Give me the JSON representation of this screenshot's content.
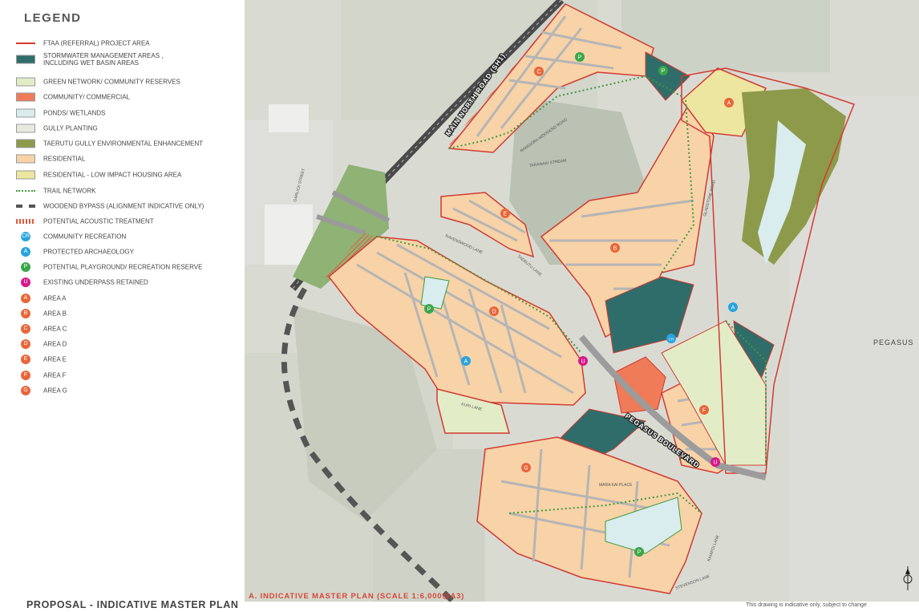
{
  "legend": {
    "title": "LEGEND",
    "items": [
      {
        "label": "FTAA (REFERRAL) PROJECT AREA",
        "symbol": "red-line",
        "color": "#d23a31"
      },
      {
        "label": "STORMWATER MANAGEMENT AREAS ,\nINCLUDING WET BASIN AREAS",
        "symbol": "fill",
        "color": "#2f6d6a"
      },
      {
        "label": "GREEN NETWORK/ COMMUNITY RESERVES",
        "symbol": "fill",
        "color": "#e2edc8"
      },
      {
        "label": "COMMUNITY/ COMMERCIAL",
        "symbol": "fill",
        "color": "#ef7b59"
      },
      {
        "label": "PONDS/ WETLANDS",
        "symbol": "fill",
        "color": "#d9ecee"
      },
      {
        "label": "GULLY PLANTING",
        "symbol": "fill",
        "color": "#e9eadf"
      },
      {
        "label": "TAERUTU GULLY ENVIRONMENTAL ENHANCEMENT",
        "symbol": "fill",
        "color": "#8d9a4a"
      },
      {
        "label": "RESIDENTIAL",
        "symbol": "fill",
        "color": "#f8d3a8"
      },
      {
        "label": "RESIDENTIAL - LOW IMPACT HOUSING AREA",
        "symbol": "fill",
        "color": "#ede6a0"
      },
      {
        "label": "TRAIL NETWORK",
        "symbol": "dots",
        "color": "#3f9a3a"
      },
      {
        "label": "WOODEND BYPASS (ALIGNMENT INDICATIVE ONLY)",
        "symbol": "dash",
        "color": "#555555"
      },
      {
        "label": "POTENTIAL ACOUSTIC TREATMENT",
        "symbol": "hatch",
        "color": "#e25b3c"
      },
      {
        "label": "COMMUNITY RECREATION",
        "symbol": "circle",
        "color": "#29a3dc",
        "letter": "CR"
      },
      {
        "label": "PROTECTED ARCHAEOLOGY",
        "symbol": "circle",
        "color": "#29a3dc",
        "letter": "A"
      },
      {
        "label": "POTENTIAL PLAYGROUND/ RECREATION RESERVE",
        "symbol": "circle",
        "color": "#3aa64a",
        "letter": "P"
      },
      {
        "label": "EXISTING UNDERPASS RETAINED",
        "symbol": "circle",
        "color": "#d6198a",
        "letter": "U"
      },
      {
        "label": "AREA A",
        "symbol": "circle",
        "color": "#e8663a",
        "letter": "A"
      },
      {
        "label": "AREA B",
        "symbol": "circle",
        "color": "#e8663a",
        "letter": "B"
      },
      {
        "label": "AREA C",
        "symbol": "circle",
        "color": "#e8663a",
        "letter": "C"
      },
      {
        "label": "AREA D",
        "symbol": "circle",
        "color": "#e8663a",
        "letter": "D"
      },
      {
        "label": "AREA E",
        "symbol": "circle",
        "color": "#e8663a",
        "letter": "E"
      },
      {
        "label": "AREA F",
        "symbol": "circle",
        "color": "#e8663a",
        "letter": "F"
      },
      {
        "label": "AREA G",
        "symbol": "circle",
        "color": "#e8663a",
        "letter": "G"
      }
    ]
  },
  "map": {
    "labels": {
      "main_north_road": "MAIN NORTH ROAD (SH1)",
      "pegasus_boulevard": "PEGASUS BOULEVARD",
      "pegasus": "PEGASUS",
      "garlick_street": "GARLICK STREET",
      "taranaki_stream": "TARANAKI STREAM",
      "rangiora_woodend_road": "RANGIORA WOODEND ROAD",
      "gladstone_road": "GLADSTONE ROAD",
      "kuri_lane": "KURI LANE",
      "ravenswood_lane": "RAVENSWOOD LANE",
      "taerutu_lane": "TAERUTU LANE",
      "mara_kai_place": "MARA KAI PLACE",
      "kaiapoi_lane": "KAIAPOI LANE",
      "stevenson_lane": "STEVENSON LANE"
    },
    "markers": [
      {
        "letter": "P",
        "color": "#3aa64a"
      },
      {
        "letter": "P",
        "color": "#3aa64a"
      },
      {
        "letter": "P",
        "color": "#3aa64a"
      },
      {
        "letter": "P",
        "color": "#3aa64a"
      },
      {
        "letter": "C",
        "color": "#e8663a"
      },
      {
        "letter": "E",
        "color": "#e8663a"
      },
      {
        "letter": "B",
        "color": "#e8663a"
      },
      {
        "letter": "D",
        "color": "#e8663a"
      },
      {
        "letter": "A",
        "color": "#e8663a"
      },
      {
        "letter": "F",
        "color": "#e8663a"
      },
      {
        "letter": "G",
        "color": "#e8663a"
      },
      {
        "letter": "A",
        "color": "#29a3dc"
      },
      {
        "letter": "A",
        "color": "#29a3dc"
      },
      {
        "letter": "CR",
        "color": "#29a3dc"
      },
      {
        "letter": "U",
        "color": "#d6198a"
      },
      {
        "letter": "U",
        "color": "#d6198a"
      }
    ]
  },
  "footer": {
    "title": "PROPOSAL - INDICATIVE MASTER PLAN",
    "map_caption": "A. INDICATIVE MASTER PLAN  (SCALE 1:6,000@A3)",
    "disclaimer": "This drawing is indicative only, subject to change"
  }
}
